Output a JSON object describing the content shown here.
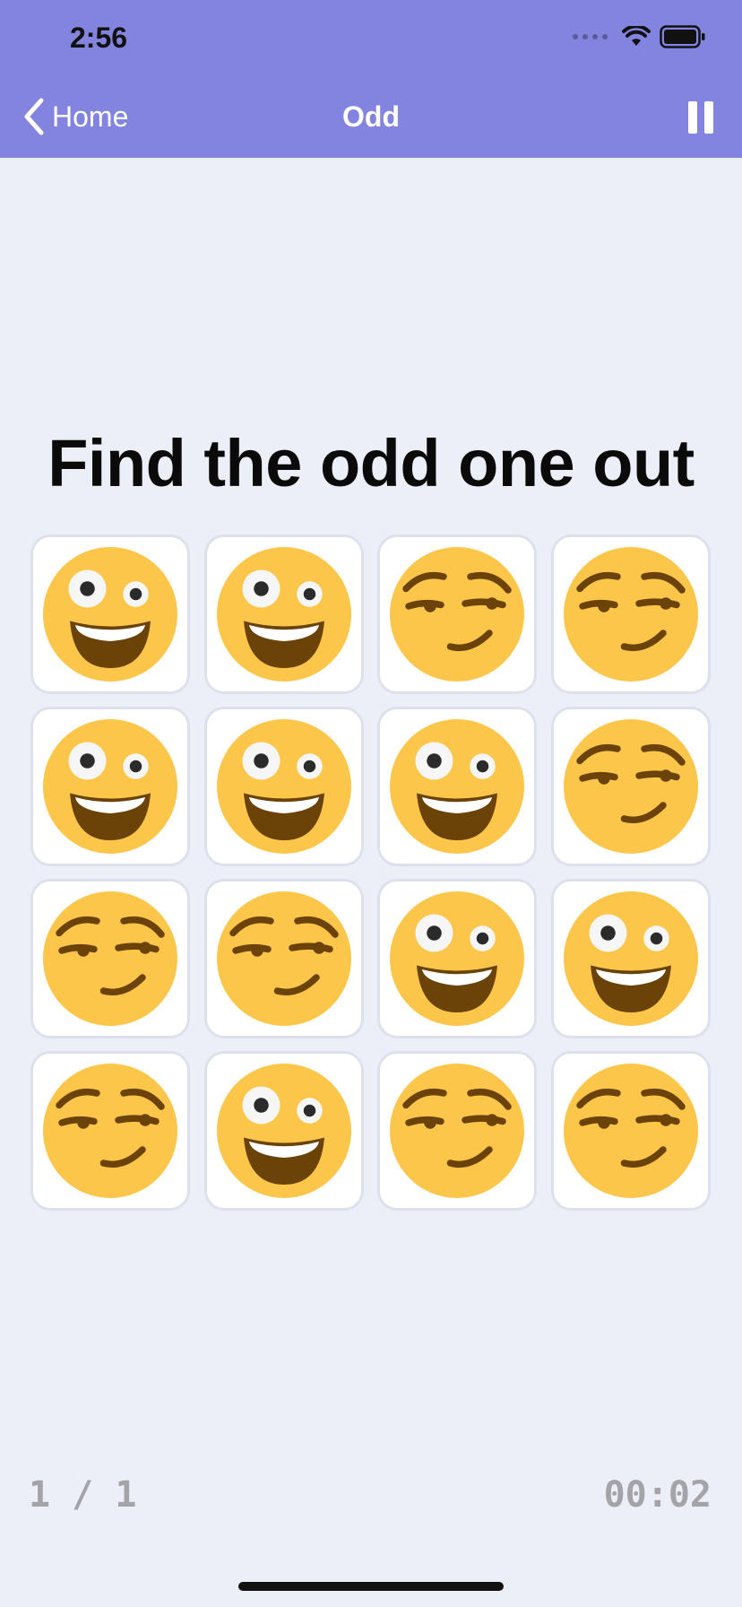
{
  "status_bar": {
    "time": "2:56"
  },
  "nav": {
    "back_label": "Home",
    "title": "Odd"
  },
  "game": {
    "prompt": "Find the odd one out",
    "tiles": [
      "grinning-squinting",
      "grinning-squinting",
      "smirking",
      "smirking",
      "grinning-squinting",
      "grinning-squinting",
      "grinning-squinting",
      "smirking",
      "smirking",
      "smirking",
      "grinning-squinting",
      "grinning-squinting",
      "smirking",
      "grinning-squinting",
      "smirking",
      "smirking"
    ]
  },
  "footer": {
    "progress": "1 / 1",
    "timer": "00:02"
  },
  "colors": {
    "header": "#8383e0",
    "background": "#eceff7",
    "emoji_face": "#fcc64a",
    "emoji_feature": "#6b4208"
  }
}
